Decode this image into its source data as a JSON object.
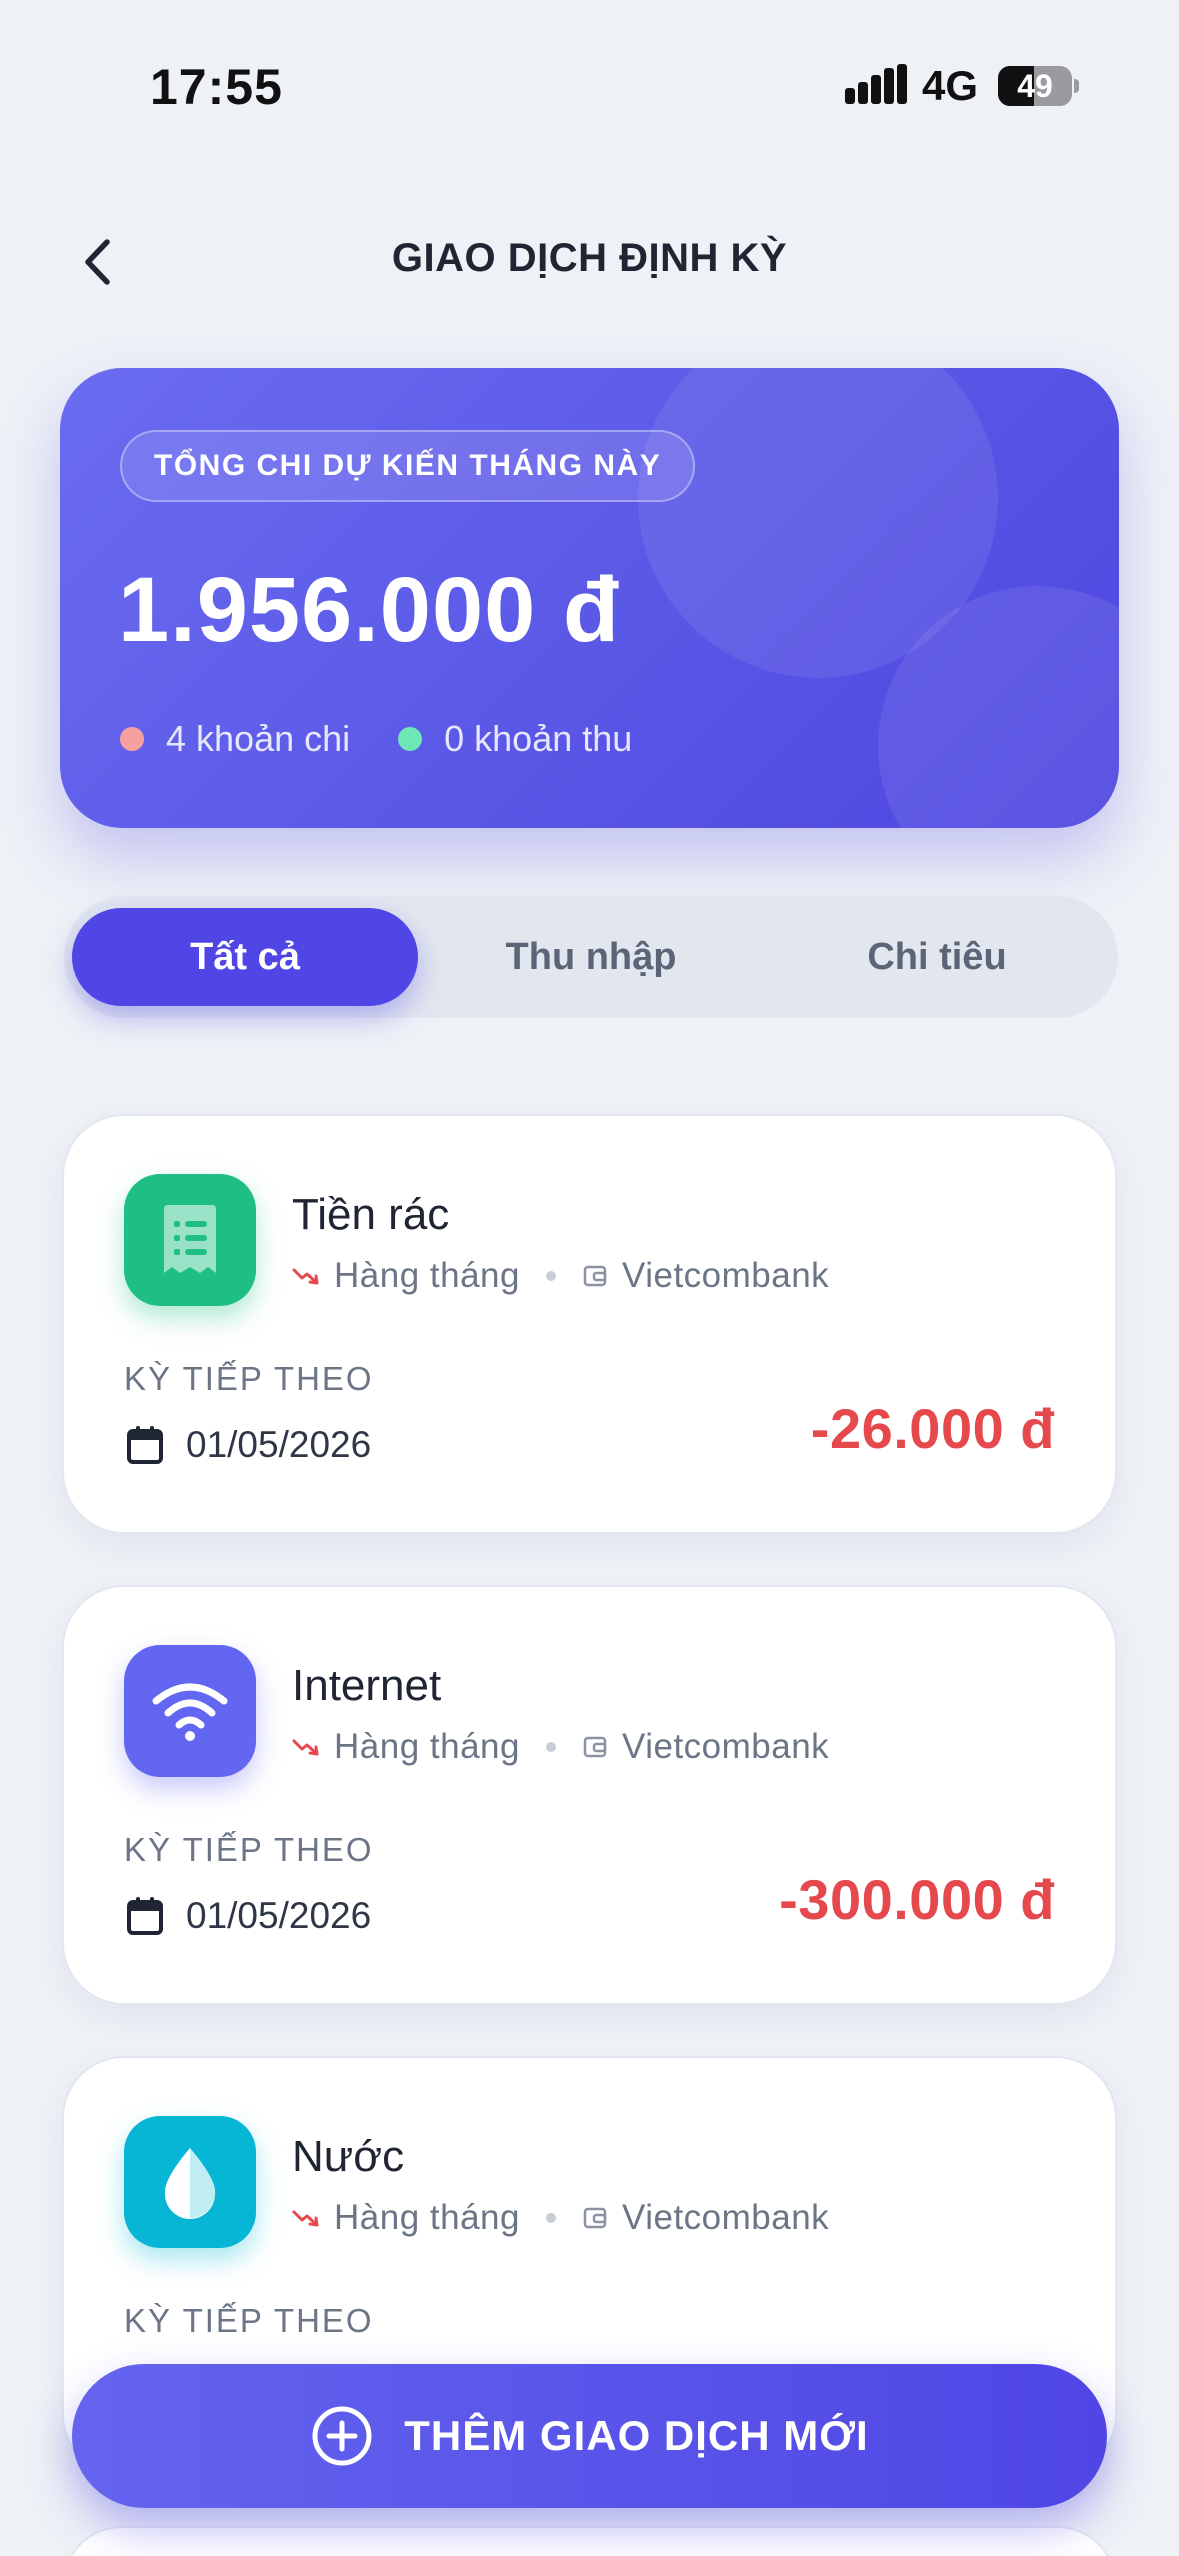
{
  "status_bar": {
    "time": "17:55",
    "network": "4G",
    "battery": "49",
    "battery_level": 0.49
  },
  "header": {
    "title": "GIAO DỊCH ĐỊNH KỲ",
    "back_icon": "chevron-left-icon"
  },
  "summary": {
    "badge": "TỔNG CHI DỰ KIẾN THÁNG NÀY",
    "amount": "1.956.000 đ",
    "expense_count": "4 khoản chi",
    "income_count": "0 khoản thu",
    "expense_dot_color": "#f7a0a0",
    "income_dot_color": "#6ee7b7"
  },
  "tabs": [
    {
      "label": "Tất cả",
      "active": true
    },
    {
      "label": "Thu nhập",
      "active": false
    },
    {
      "label": "Chi tiêu",
      "active": false
    }
  ],
  "transactions": [
    {
      "title": "Tiền rác",
      "frequency": "Hàng tháng",
      "account": "Vietcombank",
      "next_label": "KỲ TIẾP THEO",
      "next_date": "01/05/2026",
      "amount": "-26.000 đ",
      "icon": "receipt-icon",
      "icon_color": "#1fbf83"
    },
    {
      "title": "Internet",
      "frequency": "Hàng tháng",
      "account": "Vietcombank",
      "next_label": "KỲ TIẾP THEO",
      "next_date": "01/05/2026",
      "amount": "-300.000 đ",
      "icon": "wifi-icon",
      "icon_color": "#6366f1"
    },
    {
      "title": "Nước",
      "frequency": "Hàng tháng",
      "account": "Vietcombank",
      "next_label": "KỲ TIẾP THEO",
      "next_date": "",
      "amount": "",
      "icon": "water-drop-icon",
      "icon_color": "#06b6d4"
    }
  ],
  "add_button": {
    "label": "THÊM GIAO DỊCH MỚI",
    "icon": "plus-circle-icon"
  },
  "colors": {
    "accent": "#4f46e5",
    "expense": "#e5484d",
    "background": "#eef1f6"
  }
}
